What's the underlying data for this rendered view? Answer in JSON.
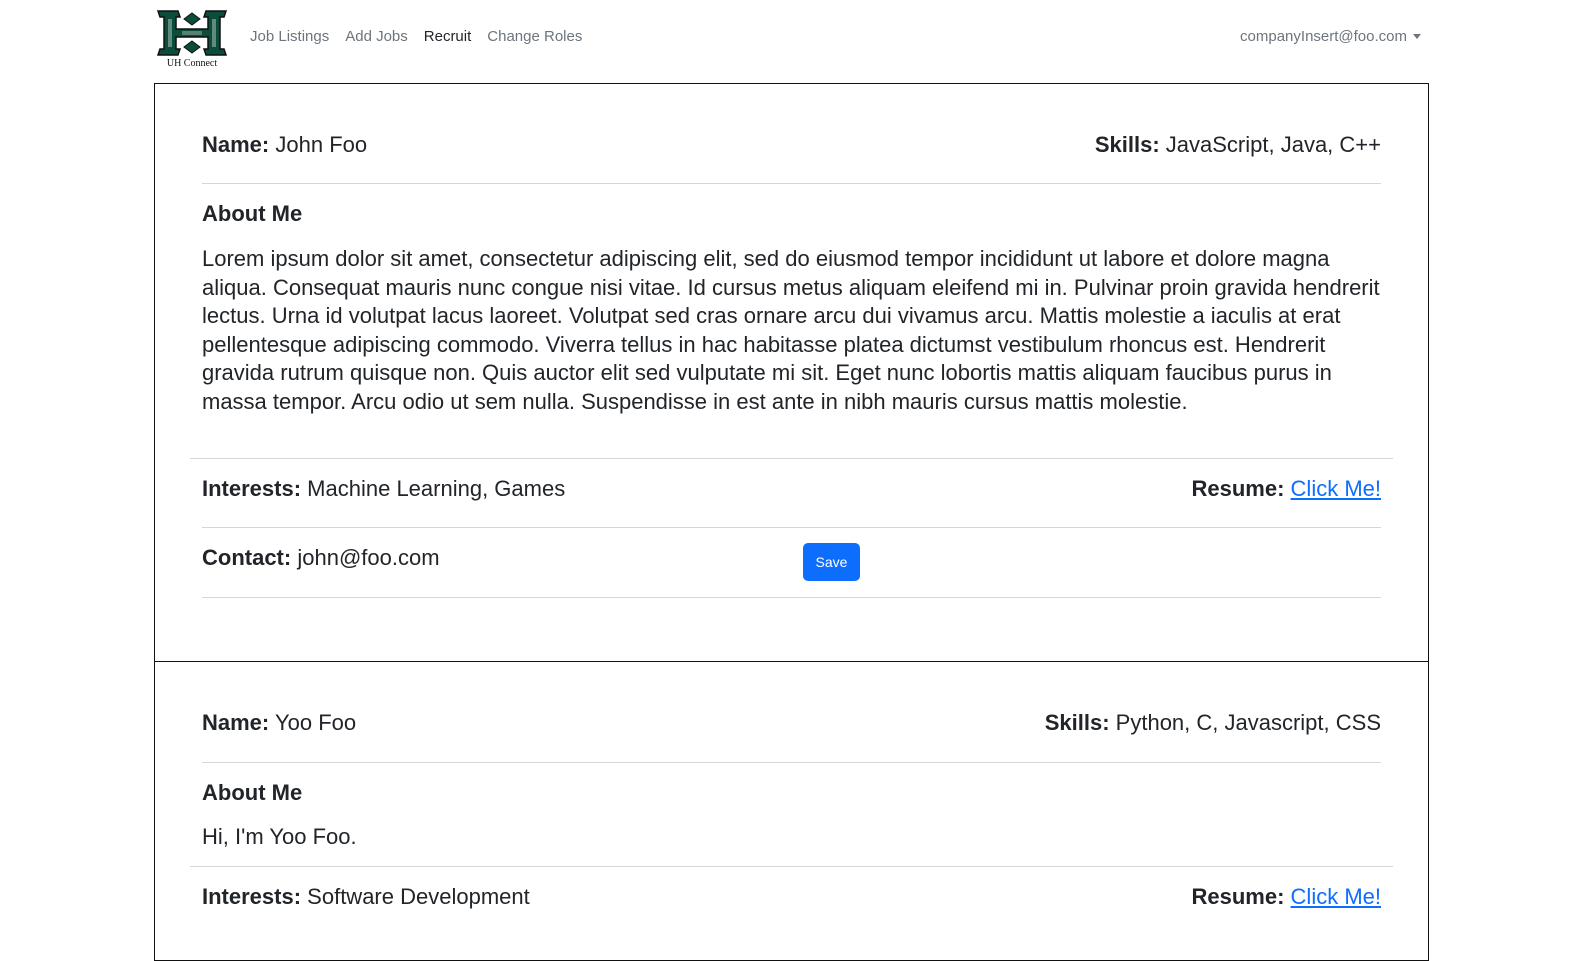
{
  "nav": {
    "brand_caption": "UH Connect",
    "links": [
      "Job Listings",
      "Add Jobs",
      "Recruit",
      "Change Roles"
    ],
    "user_email": "companyInsert@foo.com"
  },
  "labels": {
    "name": "Name:",
    "skills": "Skills:",
    "about": "About Me",
    "interests": "Interests:",
    "resume": "Resume:",
    "contact": "Contact:",
    "resume_link": "Click Me!",
    "save": "Save"
  },
  "profiles": [
    {
      "name": "John Foo",
      "skills": "JavaScript, Java, C++",
      "about": "Lorem ipsum dolor sit amet, consectetur adipiscing elit, sed do eiusmod tempor incididunt ut labore et dolore magna aliqua. Consequat mauris nunc congue nisi vitae. Id cursus metus aliquam eleifend mi in. Pulvinar proin gravida hendrerit lectus. Urna id volutpat lacus laoreet. Volutpat sed cras ornare arcu dui vivamus arcu. Mattis molestie a iaculis at erat pellentesque adipiscing commodo. Viverra tellus in hac habitasse platea dictumst vestibulum rhoncus est. Hendrerit gravida rutrum quisque non. Quis auctor elit sed vulputate mi sit. Eget nunc lobortis mattis aliquam faucibus purus in massa tempor. Arcu odio ut sem nulla. Suspendisse in est ante in nibh mauris cursus mattis molestie.",
      "interests": "Machine Learning, Games",
      "contact": "john@foo.com"
    },
    {
      "name": "Yoo Foo",
      "skills": "Python, C, Javascript, CSS",
      "about": "Hi, I'm Yoo Foo.",
      "interests": "Software Development"
    }
  ],
  "colors": {
    "brand_green": "#0b4d3a",
    "link_blue": "#0d6efd",
    "nav_gray": "#6c757d"
  }
}
